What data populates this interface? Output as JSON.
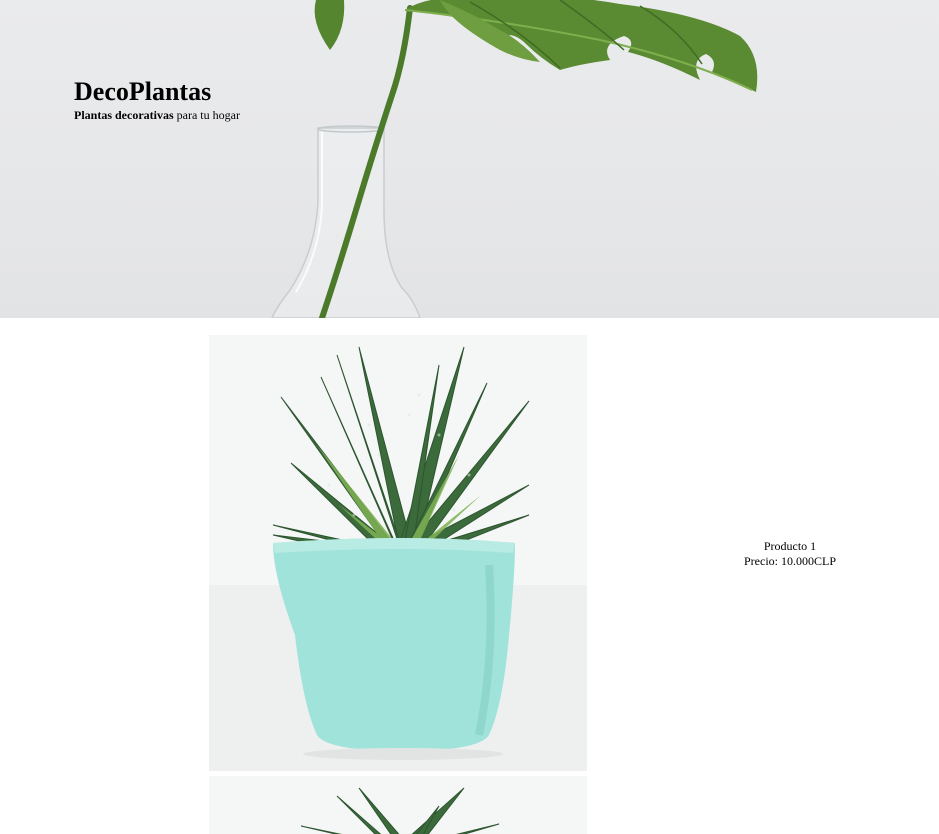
{
  "header": {
    "title": "DecoPlantas",
    "tagline_bold": "Plantas decorativas",
    "tagline_rest": " para tu hogar"
  },
  "products": [
    {
      "name": "Producto 1",
      "price_label": "Precio: 10.000CLP",
      "pot_color": "#9fe3da"
    }
  ],
  "colors": {
    "hero_background": "#e8e9eb",
    "leaf": "#4f7d2f",
    "succulent": "#3b6a3a",
    "pot": "#9fe3da"
  }
}
